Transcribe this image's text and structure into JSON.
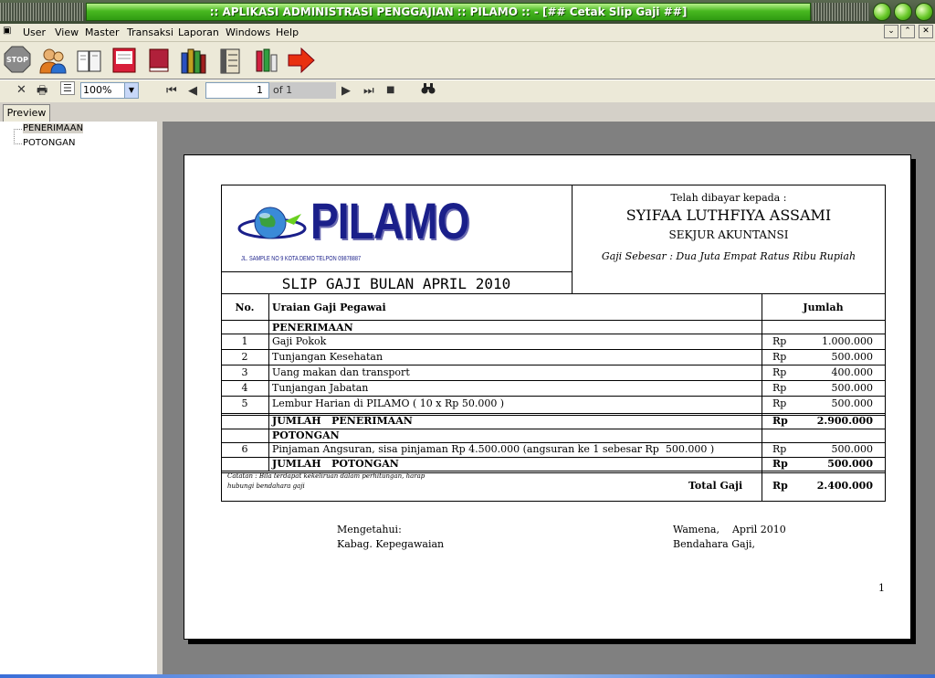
{
  "window": {
    "title": ":: APLIKASI ADMINISTRASI PENGGAJIAN :: PILAMO :: - [## Cetak Slip Gaji ##]"
  },
  "menu": [
    "User",
    "View",
    "Master",
    "Transaksi",
    "Laporan",
    "Windows",
    "Help"
  ],
  "toolbar": {
    "icons": [
      "stop-icon",
      "users-icon",
      "book-open-icon",
      "notebook-icon",
      "book-icon",
      "books-icon",
      "binder-icon",
      "pencils-icon",
      "exit-arrow-icon"
    ],
    "stop_label": "STOP"
  },
  "preview_toolbar": {
    "zoom": "100%",
    "page": "1",
    "of_pages": "of 1"
  },
  "tab": {
    "label": "Preview"
  },
  "tree": [
    "PENERIMAAN",
    "POTONGAN"
  ],
  "colors": {
    "title_green": "#48b820",
    "logo_blue": "#1a1f8a"
  },
  "slip": {
    "logo_text": "PILAMO",
    "address": "JL. SAMPLE NO 9 KOTA DEMO TELPON 09878887",
    "title": "SLIP GAJI BULAN APRIL 2010",
    "paid_to": "Telah dibayar kepada :",
    "name": "SYIFAA LUTHFIYA ASSAMI",
    "dept": "SEKJUR AKUNTANSI",
    "amount_words": "Gaji Sebesar : Dua Juta Empat Ratus Ribu Rupiah",
    "col_no": "No.",
    "col_desc": "Uraian Gaji Pegawai",
    "col_amount": "Jumlah",
    "sec_income": "PENERIMAAN",
    "income_rows": [
      {
        "no": "1",
        "desc": "Gaji Pokok",
        "cur": "Rp",
        "val": "1.000.000"
      },
      {
        "no": "2",
        "desc": "Tunjangan Kesehatan",
        "cur": "Rp",
        "val": "500.000"
      },
      {
        "no": "3",
        "desc": "Uang makan dan transport",
        "cur": "Rp",
        "val": "400.000"
      },
      {
        "no": "4",
        "desc": "Tunjangan Jabatan",
        "cur": "Rp",
        "val": "500.000"
      },
      {
        "no": "5",
        "desc": "Lembur Harian di PILAMO ( 10 x Rp  50.000 )",
        "cur": "Rp",
        "val": "500.000"
      }
    ],
    "total_income_label": "JUMLAH   PENERIMAAN",
    "total_income_cur": "Rp",
    "total_income": "2.900.000",
    "sec_deduct": "POTONGAN",
    "deduct_rows": [
      {
        "no": "6",
        "desc": "Pinjaman Angsuran, sisa pinjaman Rp 4.500.000 (angsuran ke 1 sebesar Rp  500.000 )",
        "cur": "Rp",
        "val": "500.000"
      }
    ],
    "total_deduct_label": "JUMLAH   POTONGAN",
    "total_deduct_cur": "Rp",
    "total_deduct": "500.000",
    "note_line1": "Catatan : Bila terdapat kekeliruan dalam perhitungan, harap",
    "note_line2": "hubungi bendahara gaji",
    "total_label": "Total Gaji",
    "total_cur": "Rp",
    "total": "2.400.000",
    "sign_left_1": "Mengetahui:",
    "sign_left_2": "Kabag. Kepegawaian",
    "sign_right_1": "Wamena,    April 2010",
    "sign_right_2": "Bendahara Gaji,",
    "page_number": "1"
  }
}
